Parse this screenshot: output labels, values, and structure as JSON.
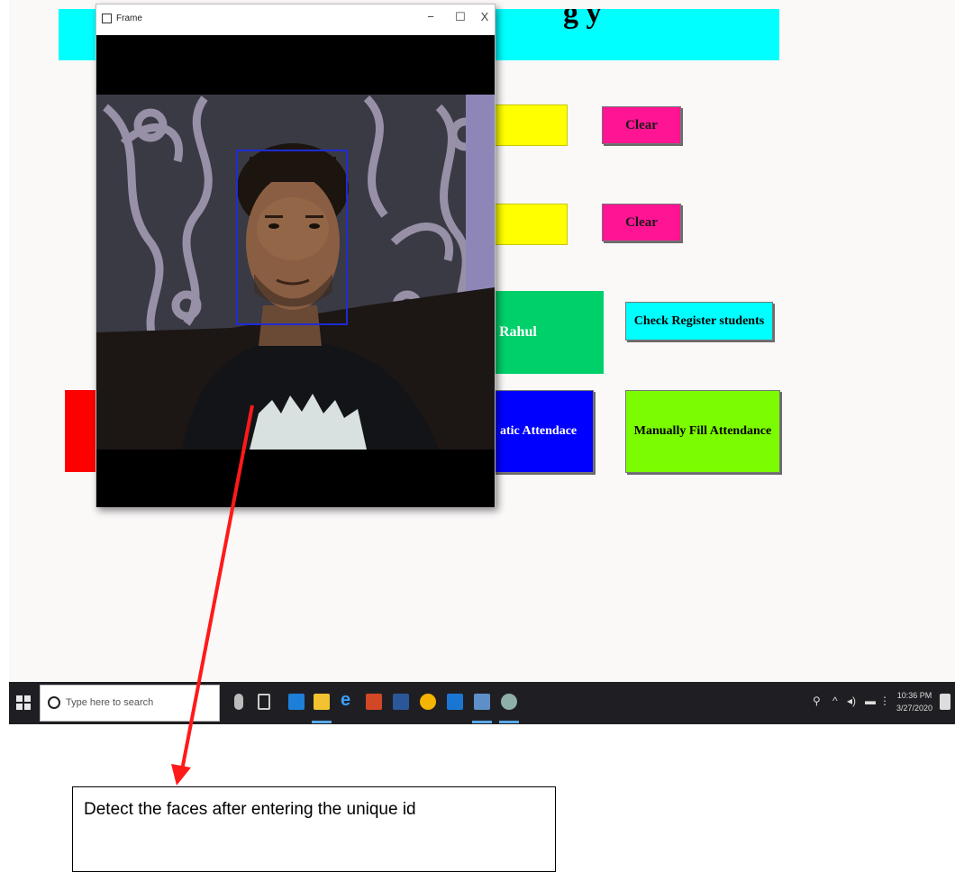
{
  "app": {
    "title_fragment": "g   y",
    "clear_label_1": "Clear",
    "clear_label_2": "Clear",
    "notification_text": "Rahul",
    "check_register_label": "Check Register students",
    "automatic_attendance_label": "atic Attendace",
    "manual_attendance_label": "Manually Fill Attendance"
  },
  "frame_window": {
    "title": "Frame",
    "minimize_glyph": "−",
    "maximize_glyph": "☐",
    "close_glyph": "X"
  },
  "taskbar": {
    "search_placeholder": "Type here to search",
    "time": "10:36 PM",
    "date": "3/27/2020",
    "app_icons": [
      "task-view-icon",
      "store-icon",
      "file-explorer-icon",
      "edge-icon",
      "powerpoint-icon",
      "word-icon",
      "chrome-icon",
      "mail-icon",
      "python-idle-icon",
      "paint-icon"
    ]
  },
  "caption": {
    "text": "Detect the faces after entering the unique id"
  },
  "colors": {
    "title_banner": "#00ffff",
    "input_field": "#ffff00",
    "clear_button": "#ff1493",
    "notification": "#00d06a",
    "check_register_button": "#00ffff",
    "automatic_attendance_button": "#0000ff",
    "manual_attendance_button": "#7cfc00",
    "red_block": "#ff0000",
    "face_box": "#1e2bd6",
    "arrow": "#ff1a1a"
  }
}
